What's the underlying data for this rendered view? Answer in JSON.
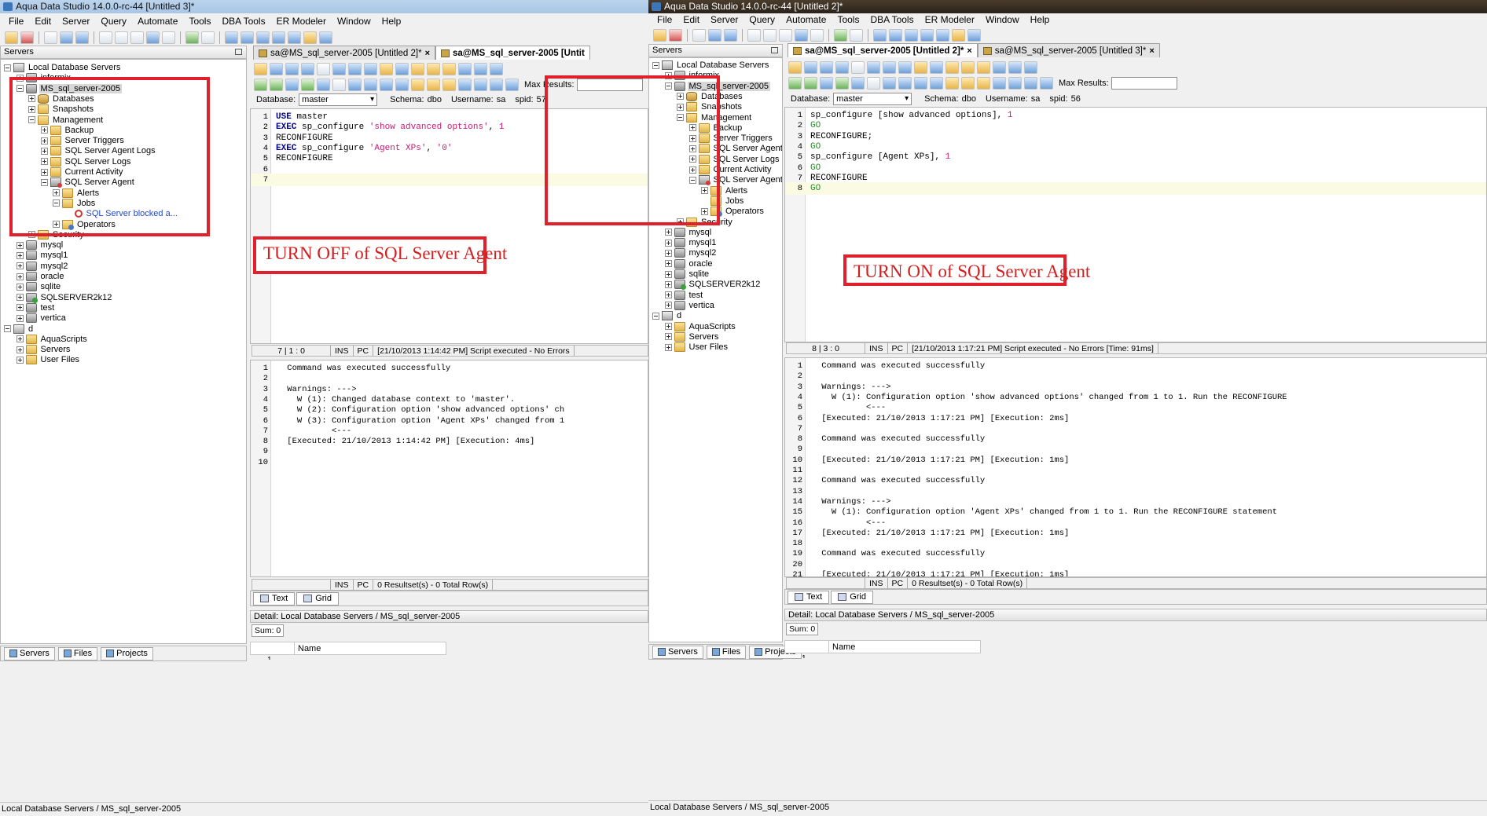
{
  "left": {
    "title": "Aqua Data Studio 14.0.0-rc-44 [Untitled 3]*",
    "menu": [
      "File",
      "Edit",
      "Server",
      "Query",
      "Automate",
      "Tools",
      "DBA Tools",
      "ER Modeler",
      "Window",
      "Help"
    ],
    "servers_panel_title": "Servers",
    "tree": [
      {
        "label": "Local Database Servers",
        "level": 0,
        "icon": "root",
        "expander": "minus"
      },
      {
        "label": "informix",
        "level": 1,
        "icon": "server",
        "expander": "plus"
      },
      {
        "label": "MS_sql_server-2005",
        "level": 1,
        "icon": "server",
        "expander": "minus",
        "selected": true
      },
      {
        "label": "Databases",
        "level": 2,
        "icon": "db",
        "expander": "plus"
      },
      {
        "label": "Snapshots",
        "level": 2,
        "icon": "folder",
        "expander": "plus"
      },
      {
        "label": "Management",
        "level": 2,
        "icon": "folder",
        "expander": "minus"
      },
      {
        "label": "Backup",
        "level": 3,
        "icon": "folder",
        "expander": "plus"
      },
      {
        "label": "Server Triggers",
        "level": 3,
        "icon": "folder",
        "expander": "plus"
      },
      {
        "label": "SQL Server Agent Logs",
        "level": 3,
        "icon": "folder",
        "expander": "plus"
      },
      {
        "label": "SQL Server Logs",
        "level": 3,
        "icon": "folder",
        "expander": "plus"
      },
      {
        "label": "Current Activity",
        "level": 3,
        "icon": "folder",
        "expander": "plus"
      },
      {
        "label": "SQL Server Agent",
        "level": 3,
        "icon": "agent",
        "expander": "minus"
      },
      {
        "label": "Alerts",
        "level": 4,
        "icon": "folder",
        "expander": "plus"
      },
      {
        "label": "Jobs",
        "level": 4,
        "icon": "folder",
        "expander": "minus"
      },
      {
        "label": "SQL Server blocked a...",
        "level": 5,
        "icon": "job",
        "expander": "none",
        "link": true
      },
      {
        "label": "Operators",
        "level": 4,
        "icon": "ops",
        "expander": "plus"
      },
      {
        "label": "Security",
        "level": 2,
        "icon": "folder",
        "expander": "plus"
      },
      {
        "label": "mysql",
        "level": 1,
        "icon": "server",
        "expander": "plus"
      },
      {
        "label": "mysql1",
        "level": 1,
        "icon": "server",
        "expander": "plus"
      },
      {
        "label": "mysql2",
        "level": 1,
        "icon": "server",
        "expander": "plus"
      },
      {
        "label": "oracle",
        "level": 1,
        "icon": "server",
        "expander": "plus"
      },
      {
        "label": "sqlite",
        "level": 1,
        "icon": "server",
        "expander": "plus"
      },
      {
        "label": "SQLSERVER2k12",
        "level": 1,
        "icon": "server-g",
        "expander": "plus"
      },
      {
        "label": "test",
        "level": 1,
        "icon": "server",
        "expander": "plus"
      },
      {
        "label": "vertica",
        "level": 1,
        "icon": "server",
        "expander": "plus"
      },
      {
        "label": "d",
        "level": 0,
        "icon": "root",
        "expander": "minus"
      },
      {
        "label": "AquaScripts",
        "level": 1,
        "icon": "folder",
        "expander": "plus"
      },
      {
        "label": "Servers",
        "level": 1,
        "icon": "folder",
        "expander": "plus"
      },
      {
        "label": "User Files",
        "level": 1,
        "icon": "folder",
        "expander": "plus"
      }
    ],
    "tabs": [
      {
        "label": "sa@MS_sql_server-2005 [Untitled 2]*",
        "active": false,
        "close": "×"
      },
      {
        "label": "sa@MS_sql_server-2005 [Untit",
        "active": true,
        "close": ""
      }
    ],
    "max_results_label": "Max Results:",
    "db_label": "Database:",
    "db_value": "master",
    "schema_label": "Schema:",
    "schema_value": "dbo",
    "username_label": "Username:",
    "username_value": "sa",
    "spid_label": "spid:",
    "spid_value": "57",
    "code": [
      [
        {
          "t": "USE",
          "c": "kw"
        },
        {
          "t": " master",
          "c": ""
        }
      ],
      [
        {
          "t": "EXEC",
          "c": "kw"
        },
        {
          "t": " sp_configure ",
          "c": ""
        },
        {
          "t": "'show advanced options'",
          "c": "str"
        },
        {
          "t": ", ",
          "c": ""
        },
        {
          "t": "1",
          "c": "num"
        }
      ],
      [
        {
          "t": "RECONFIGURE",
          "c": ""
        }
      ],
      [
        {
          "t": "EXEC",
          "c": "kw"
        },
        {
          "t": " sp_configure ",
          "c": ""
        },
        {
          "t": "'Agent XPs'",
          "c": "str"
        },
        {
          "t": ", ",
          "c": ""
        },
        {
          "t": "'0'",
          "c": "str"
        }
      ],
      [
        {
          "t": "RECONFIGURE",
          "c": ""
        }
      ],
      [
        {
          "t": "",
          "c": ""
        }
      ],
      [
        {
          "t": "",
          "c": ""
        }
      ]
    ],
    "editor_status": {
      "pos": "7 | 1 : 0",
      "mode": "INS",
      "eol": "PC",
      "message": "[21/10/2013 1:14:42 PM] Script executed - No Errors"
    },
    "results": [
      " Command was executed successfully",
      "",
      " Warnings: --->",
      "   W (1): Changed database context to 'master'.",
      "   W (2): Configuration option 'show advanced options' ch",
      "   W (3): Configuration option 'Agent XPs' changed from 1",
      "          <---",
      " [Executed: 21/10/2013 1:14:42 PM] [Execution: 4ms]",
      "",
      ""
    ],
    "results_status": {
      "mode": "INS",
      "eol": "PC",
      "message": "0 Resultset(s) - 0 Total Row(s)"
    },
    "result_tabs": [
      "Text",
      "Grid"
    ],
    "detail": "Detail: Local Database Servers / MS_sql_server-2005",
    "sum": "Sum: 0",
    "grid_col": "Name",
    "grid_row_num": "1",
    "bottom_tabs": [
      "Servers",
      "Files",
      "Projects"
    ],
    "status": "Local Database Servers / MS_sql_server-2005",
    "annotation": "TURN OFF of SQL Server Agent"
  },
  "right": {
    "title": "Aqua Data Studio 14.0.0-rc-44 [Untitled 2]*",
    "menu": [
      "File",
      "Edit",
      "Server",
      "Query",
      "Automate",
      "Tools",
      "DBA Tools",
      "ER Modeler",
      "Window",
      "Help"
    ],
    "servers_panel_title": "Servers",
    "tree": [
      {
        "label": "Local Database Servers",
        "level": 0,
        "icon": "root",
        "expander": "minus"
      },
      {
        "label": "informix",
        "level": 1,
        "icon": "server",
        "expander": "plus"
      },
      {
        "label": "MS_sql_server-2005",
        "level": 1,
        "icon": "server",
        "expander": "minus",
        "selected": true
      },
      {
        "label": "Databases",
        "level": 2,
        "icon": "db",
        "expander": "plus"
      },
      {
        "label": "Snapshots",
        "level": 2,
        "icon": "folder",
        "expander": "plus"
      },
      {
        "label": "Management",
        "level": 2,
        "icon": "folder",
        "expander": "minus"
      },
      {
        "label": "Backup",
        "level": 3,
        "icon": "folder",
        "expander": "plus"
      },
      {
        "label": "Server Triggers",
        "level": 3,
        "icon": "folder",
        "expander": "plus"
      },
      {
        "label": "SQL Server Agent Logs",
        "level": 3,
        "icon": "folder",
        "expander": "plus"
      },
      {
        "label": "SQL Server Logs",
        "level": 3,
        "icon": "folder",
        "expander": "plus"
      },
      {
        "label": "Current Activity",
        "level": 3,
        "icon": "folder",
        "expander": "plus"
      },
      {
        "label": "SQL Server Agent",
        "level": 3,
        "icon": "agent",
        "expander": "minus"
      },
      {
        "label": "Alerts",
        "level": 4,
        "icon": "folder",
        "expander": "plus"
      },
      {
        "label": "Jobs",
        "level": 4,
        "icon": "folder",
        "expander": "none"
      },
      {
        "label": "Operators",
        "level": 4,
        "icon": "ops",
        "expander": "plus"
      },
      {
        "label": "Security",
        "level": 2,
        "icon": "folder",
        "expander": "plus"
      },
      {
        "label": "mysql",
        "level": 1,
        "icon": "server",
        "expander": "plus"
      },
      {
        "label": "mysql1",
        "level": 1,
        "icon": "server",
        "expander": "plus"
      },
      {
        "label": "mysql2",
        "level": 1,
        "icon": "server",
        "expander": "plus"
      },
      {
        "label": "oracle",
        "level": 1,
        "icon": "server",
        "expander": "plus"
      },
      {
        "label": "sqlite",
        "level": 1,
        "icon": "server",
        "expander": "plus"
      },
      {
        "label": "SQLSERVER2k12",
        "level": 1,
        "icon": "server-g",
        "expander": "plus"
      },
      {
        "label": "test",
        "level": 1,
        "icon": "server",
        "expander": "plus"
      },
      {
        "label": "vertica",
        "level": 1,
        "icon": "server",
        "expander": "plus"
      },
      {
        "label": "d",
        "level": 0,
        "icon": "root",
        "expander": "minus"
      },
      {
        "label": "AquaScripts",
        "level": 1,
        "icon": "folder",
        "expander": "plus"
      },
      {
        "label": "Servers",
        "level": 1,
        "icon": "folder",
        "expander": "plus"
      },
      {
        "label": "User Files",
        "level": 1,
        "icon": "folder",
        "expander": "plus"
      }
    ],
    "tabs": [
      {
        "label": "sa@MS_sql_server-2005 [Untitled 2]*",
        "active": true,
        "close": "×"
      },
      {
        "label": "sa@MS_sql_server-2005 [Untitled 3]*",
        "active": false,
        "close": "×"
      }
    ],
    "max_results_label": "Max Results:",
    "db_label": "Database:",
    "db_value": "master",
    "schema_label": "Schema:",
    "schema_value": "dbo",
    "username_label": "Username:",
    "username_value": "sa",
    "spid_label": "spid:",
    "spid_value": "56",
    "code": [
      [
        {
          "t": "sp_configure [show advanced options], ",
          "c": ""
        },
        {
          "t": "1",
          "c": "num"
        }
      ],
      [
        {
          "t": "GO",
          "c": "go"
        }
      ],
      [
        {
          "t": "RECONFIGURE;",
          "c": ""
        }
      ],
      [
        {
          "t": "GO",
          "c": "go"
        }
      ],
      [
        {
          "t": "sp_configure [Agent XPs], ",
          "c": ""
        },
        {
          "t": "1",
          "c": "num"
        }
      ],
      [
        {
          "t": "GO",
          "c": "go"
        }
      ],
      [
        {
          "t": "RECONFIGURE",
          "c": ""
        }
      ],
      [
        {
          "t": "GO",
          "c": "go"
        }
      ]
    ],
    "editor_status": {
      "pos": "8 | 3 : 0",
      "mode": "INS",
      "eol": "PC",
      "message": "[21/10/2013 1:17:21 PM] Script executed - No Errors [Time: 91ms]"
    },
    "results": [
      " Command was executed successfully",
      "",
      " Warnings: --->",
      "   W (1): Configuration option 'show advanced options' changed from 1 to 1. Run the RECONFIGURE",
      "          <---",
      " [Executed: 21/10/2013 1:17:21 PM] [Execution: 2ms]",
      "",
      " Command was executed successfully",
      "",
      " [Executed: 21/10/2013 1:17:21 PM] [Execution: 1ms]",
      "",
      " Command was executed successfully",
      "",
      " Warnings: --->",
      "   W (1): Configuration option 'Agent XPs' changed from 1 to 1. Run the RECONFIGURE statement",
      "          <---",
      " [Executed: 21/10/2013 1:17:21 PM] [Execution: 1ms]",
      "",
      " Command was executed successfully",
      "",
      " [Executed: 21/10/2013 1:17:21 PM] [Execution: 1ms]"
    ],
    "results_status": {
      "mode": "INS",
      "eol": "PC",
      "message": "0 Resultset(s) - 0 Total Row(s)"
    },
    "result_tabs": [
      "Text",
      "Grid"
    ],
    "detail": "Detail: Local Database Servers / MS_sql_server-2005",
    "sum": "Sum: 0",
    "grid_col": "Name",
    "grid_row_num": "1",
    "bottom_tabs": [
      "Servers",
      "Files",
      "Projects"
    ],
    "status": "Local Database Servers / MS_sql_server-2005",
    "annotation": "TURN ON of SQL Server Agent"
  },
  "colors": {
    "annotation_red": "#e0202a",
    "keyword": "#00008b",
    "string": "#c61a74",
    "go": "#2e8b2e"
  }
}
